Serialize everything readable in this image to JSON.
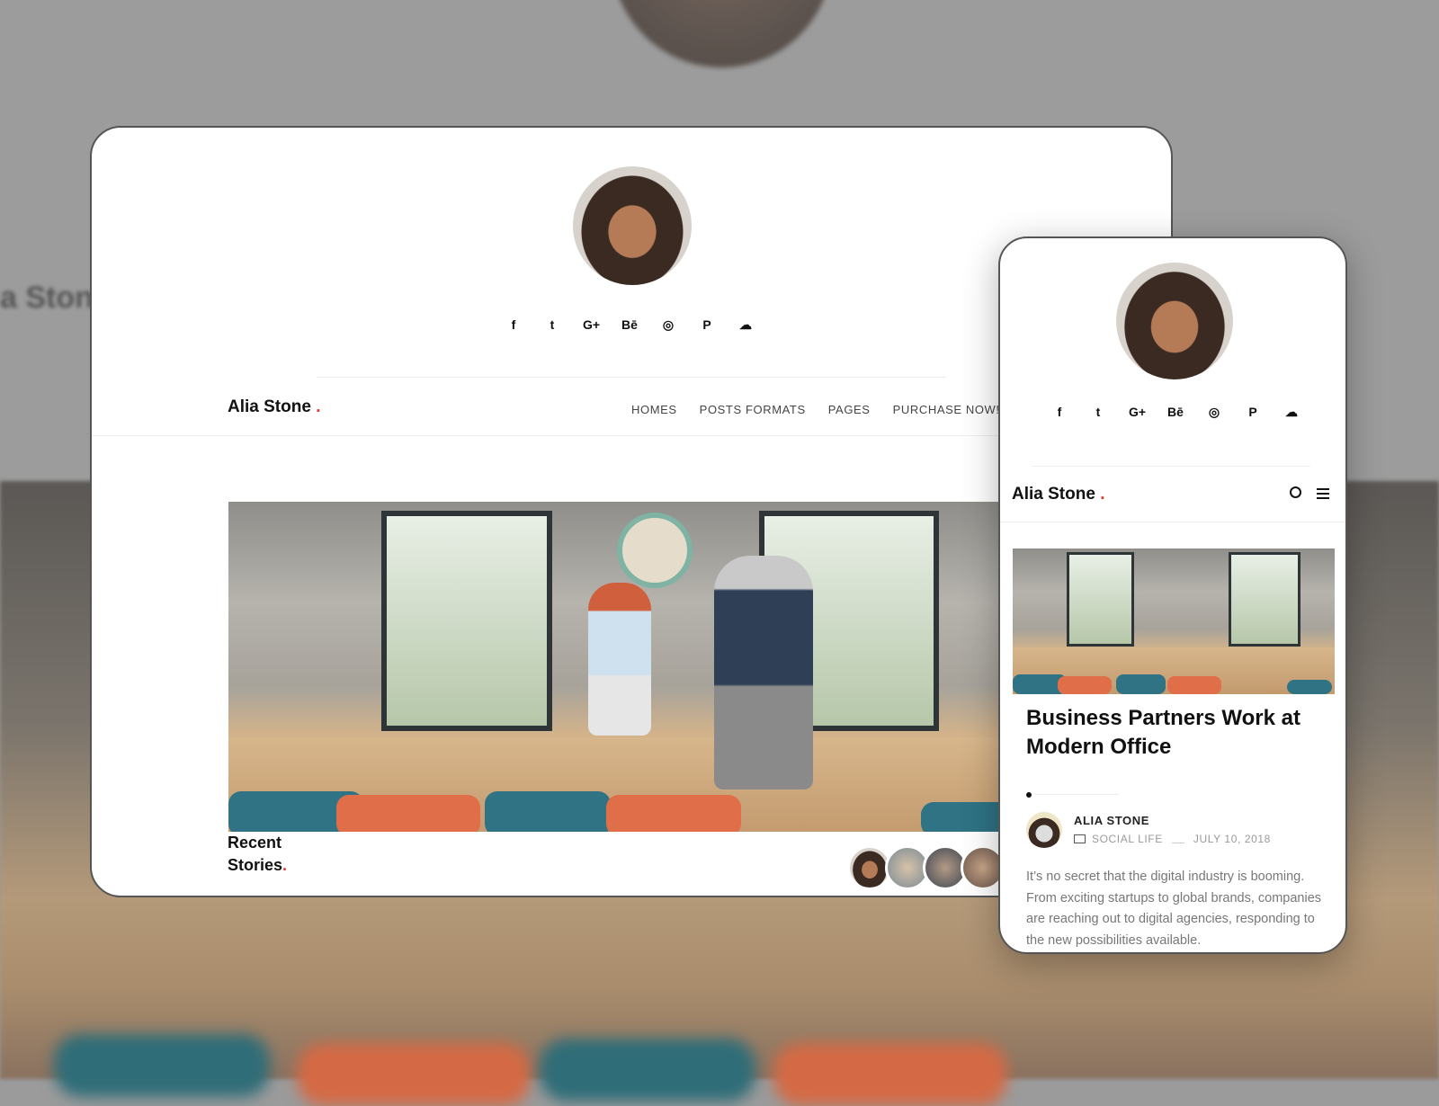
{
  "brand": {
    "name": "Alia Stone",
    "dot": "."
  },
  "socials": [
    {
      "icon": "facebook-icon",
      "glyph": "f"
    },
    {
      "icon": "twitter-icon",
      "glyph": "t"
    },
    {
      "icon": "google-plus-icon",
      "glyph": "G+"
    },
    {
      "icon": "behance-icon",
      "glyph": "Bē"
    },
    {
      "icon": "instagram-icon",
      "glyph": "◎"
    },
    {
      "icon": "pinterest-icon",
      "glyph": "P"
    },
    {
      "icon": "soundcloud-icon",
      "glyph": "☁"
    }
  ],
  "desktop": {
    "nav": [
      "HOMES",
      "POSTS FORMATS",
      "PAGES",
      "PURCHASE NOW!"
    ],
    "recent": {
      "line1": "Recent",
      "line2": "Stories",
      "dot": "."
    }
  },
  "mobile": {
    "post": {
      "title": "Business Partners Work at Modern Office",
      "author": "ALIA STONE",
      "category": "SOCIAL LIFE",
      "date": "JULY 10, 2018",
      "excerpt": "It’s no secret that the digital industry is booming. From exciting startups to global brands, companies are reaching out to digital agencies, responding to the new possibilities available."
    }
  },
  "colors": {
    "accent": "#e03a3a",
    "text": "#111111",
    "background": "#9b9b9b"
  }
}
